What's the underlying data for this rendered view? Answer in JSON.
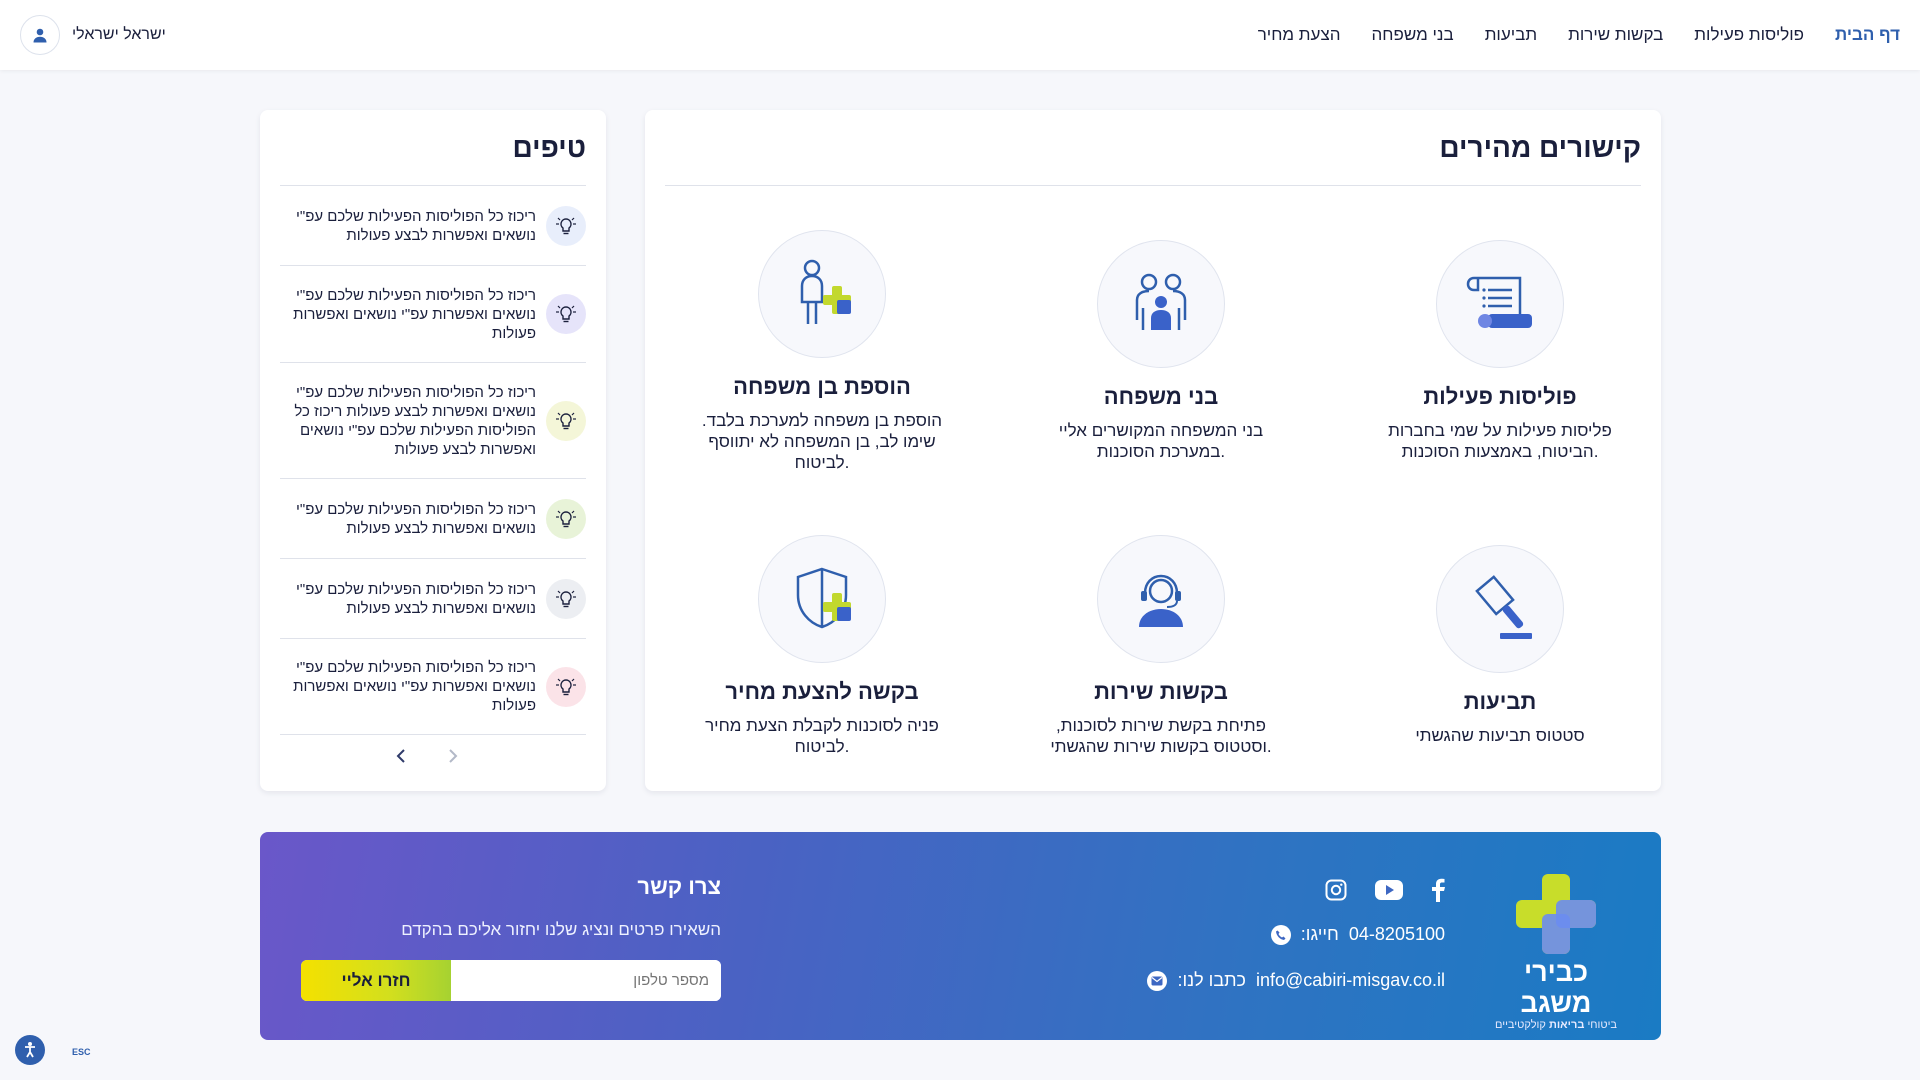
{
  "nav": {
    "items": [
      "דף הבית",
      "פוליסות פעילות",
      "בקשות שירות",
      "תביעות",
      "בני משפחה",
      "הצעת מחיר"
    ],
    "active_index": 0
  },
  "user": {
    "name": "ישראל ישראלי",
    "icon": "user-icon"
  },
  "quick_links": {
    "title": "קישורים מהירים",
    "items": [
      {
        "title": "פוליסות פעילות",
        "desc": "פליסות פעילות על שמי בחברות הביטוח, באמצעות הסוכנות.",
        "icon": "policy-scroll-icon"
      },
      {
        "title": "בני משפחה",
        "desc": "בני המשפחה המקושרים אליי במערכת הסוכנות.",
        "icon": "family-icon"
      },
      {
        "title": "הוספת בן משפחה",
        "desc": "הוספת בן משפחה למערכת בלבד. שימו לב, בן המשפחה לא יתווסף לביטוח.",
        "icon": "add-family-member-icon"
      },
      {
        "title": "תביעות",
        "desc": "סטטוס תביעות שהגשתי",
        "icon": "gavel-icon"
      },
      {
        "title": "בקשות שירות",
        "desc": "פתיחת בקשת שירות לסוכנות, וסטטוס בקשות שירות שהגשתי.",
        "icon": "headset-agent-icon"
      },
      {
        "title": "בקשה להצעת מחיר",
        "desc": "פניה לסוכנות לקבלת הצעת מחיר לביטוח.",
        "icon": "shield-plus-icon"
      }
    ]
  },
  "tips": {
    "title": "טיפים",
    "items": [
      {
        "text": "ריכוז כל הפוליסות הפעילות שלכם עפ\"י נושאים ואפשרות לבצע פעולות",
        "color": "#e8eefb"
      },
      {
        "text": "ריכוז כל הפוליסות הפעילות שלכם עפ\"י נושאים ואפשרות עפ\"י נושאים ואפשרות פעולות",
        "color": "#e6e4fa"
      },
      {
        "text": "ריכוז כל הפוליסות הפעילות שלכם עפ\"י נושאים ואפשרות לבצע פעולות ריכוז כל הפוליסות הפעילות שלכם עפ\"י נושאים ואפשרות לבצע פעולות",
        "color": "#f4f6d8"
      },
      {
        "text": "ריכוז כל הפוליסות הפעילות שלכם עפ\"י נושאים ואפשרות לבצע פעולות",
        "color": "#e8f3d8"
      },
      {
        "text": "ריכוז כל הפוליסות הפעילות שלכם עפ\"י נושאים ואפשרות לבצע פעולות",
        "color": "#eceef2"
      },
      {
        "text": "ריכוז כל הפוליסות הפעילות שלכם עפ\"י נושאים ואפשרות עפ\"י נושאים ואפשרות פעולות",
        "color": "#fbe3e8"
      }
    ]
  },
  "footer": {
    "logo_name": "כבירי משגב",
    "logo_sub_1": "ביטוחי",
    "logo_sub_2": "בריאות",
    "logo_sub_3": "קולקטיביים",
    "phone_label": "חייגו:",
    "phone": "04-8205100",
    "email_label": "כתבו לנו:",
    "email": "info@cabiri-misgav.co.il",
    "contact_title": "צרו קשר",
    "contact_sub": "השאירו פרטים ונציג שלנו יחזור אליכם בהקדם",
    "phone_placeholder": "מספר טלפון",
    "submit_label": "חזרו אליי",
    "social": [
      "facebook-icon",
      "youtube-icon",
      "instagram-icon"
    ]
  },
  "a11y": {
    "esc_label": "ESC"
  },
  "colors": {
    "primary": "#2f5fad",
    "accent_yellow": "#e9e000",
    "text": "#1a1f3c"
  }
}
